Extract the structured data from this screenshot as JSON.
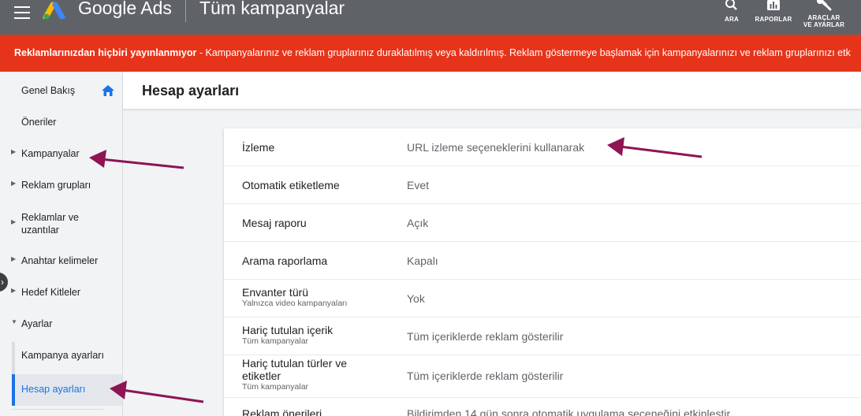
{
  "header": {
    "brand": "Google Ads",
    "page_title": "Tüm kampanyalar",
    "tools": [
      {
        "icon": "search-icon",
        "label": "ARA"
      },
      {
        "icon": "bar-chart-icon",
        "label": "RAPORLAR"
      },
      {
        "icon": "wrench-icon",
        "label_line1": "ARAÇLAR",
        "label_line2": "VE AYARLAR"
      }
    ]
  },
  "alert": {
    "bold": "Reklamlarınızdan hiçbiri yayınlanmıyor",
    "text": " - Kampanyalarınız ve reklam gruplarınız duraklatılmış veya kaldırılmış. Reklam göstermeye başlamak için kampanyalarınızı ve reklam gruplarınızı etk"
  },
  "sidebar": {
    "items": [
      {
        "label": "Genel Bakış"
      },
      {
        "label": "Öneriler"
      },
      {
        "label": "Kampanyalar"
      },
      {
        "label": "Reklam grupları"
      },
      {
        "label_line1": "Reklamlar ve",
        "label_line2": "uzantılar"
      },
      {
        "label": "Anahtar kelimeler"
      },
      {
        "label": "Hedef Kitleler"
      },
      {
        "label": "Ayarlar"
      },
      {
        "label": "Kampanya ayarları"
      },
      {
        "label": "Hesap ayarları"
      }
    ]
  },
  "main": {
    "title": "Hesap ayarları",
    "rows": [
      {
        "label": "İzleme",
        "value": "URL izleme seçeneklerini kullanarak"
      },
      {
        "label": "Otomatik etiketleme",
        "value": "Evet"
      },
      {
        "label": "Mesaj raporu",
        "value": "Açık"
      },
      {
        "label": "Arama raporlama",
        "value": "Kapalı"
      },
      {
        "label": "Envanter türü",
        "sub": "Yalnızca video kampanyaları",
        "value": "Yok"
      },
      {
        "label": "Hariç tutulan içerik",
        "sub": "Tüm kampanyalar",
        "value": "Tüm içeriklerde reklam gösterilir"
      },
      {
        "label_line1": "Hariç tutulan türler ve",
        "label_line2": "etiketler",
        "sub": "Tüm kampanyalar",
        "value": "Tüm içeriklerde reklam gösterilir"
      },
      {
        "label": "Reklam önerileri",
        "value": "Bildirimden 14 gün sonra otomatik uygulama seçeneğini etkinleştir"
      }
    ]
  },
  "colors": {
    "header_bg": "#5f6368",
    "alert_bg": "#e6341a",
    "accent_blue": "#1a73e8",
    "arrow": "#8e1454"
  }
}
